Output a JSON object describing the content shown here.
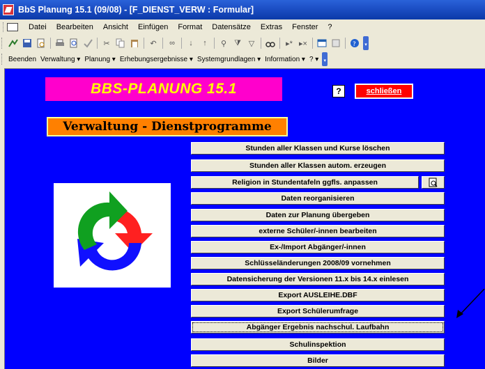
{
  "window": {
    "title": "BbS Planung 15.1 (09/08) - [F_DIENST_VERW : Formular]"
  },
  "menu": [
    "Datei",
    "Bearbeiten",
    "Ansicht",
    "Einfügen",
    "Format",
    "Datensätze",
    "Extras",
    "Fenster",
    "?"
  ],
  "custom_toolbar": [
    "Beenden",
    "Verwaltung ▾",
    "Planung ▾",
    "Erhebungsergebnisse ▾",
    "Systemgrundlagen ▾",
    "Information ▾",
    "? ▾"
  ],
  "form": {
    "banner": "BBS-PLANUNG 15.1",
    "help_label": "?",
    "close_label": "schließen",
    "section_title": "Verwaltung - Dienstprogramme",
    "buttons": [
      "Stunden aller Klassen und Kurse löschen",
      "Stunden aller Klassen autom. erzeugen",
      "Religion in Stundentafeln ggfls. anpassen",
      "Daten reorganisieren",
      "Daten zur Planung übergeben",
      "externe Schüler/-innen bearbeiten",
      "Ex-/Import Abgänger/-innen",
      "Schlüsseländerungen 2008/09 vornehmen",
      "Datensicherung der Versionen 11.x bis 14.x einlesen",
      "Export AUSLEIHE.DBF",
      "Export Schülerumfrage",
      "Abgänger Ergebnis nachschul. Laufbahn",
      "Schulinspektion",
      "Bilder"
    ]
  },
  "colors": {
    "form_bg": "#0000ff",
    "banner_bg": "#ff00cc",
    "banner_text": "#ffff00",
    "section_bg": "#ff8000",
    "close_bg": "#ff0000",
    "arrow_red": "#ff2020",
    "arrow_green": "#10a020",
    "arrow_blue": "#1010ff"
  }
}
